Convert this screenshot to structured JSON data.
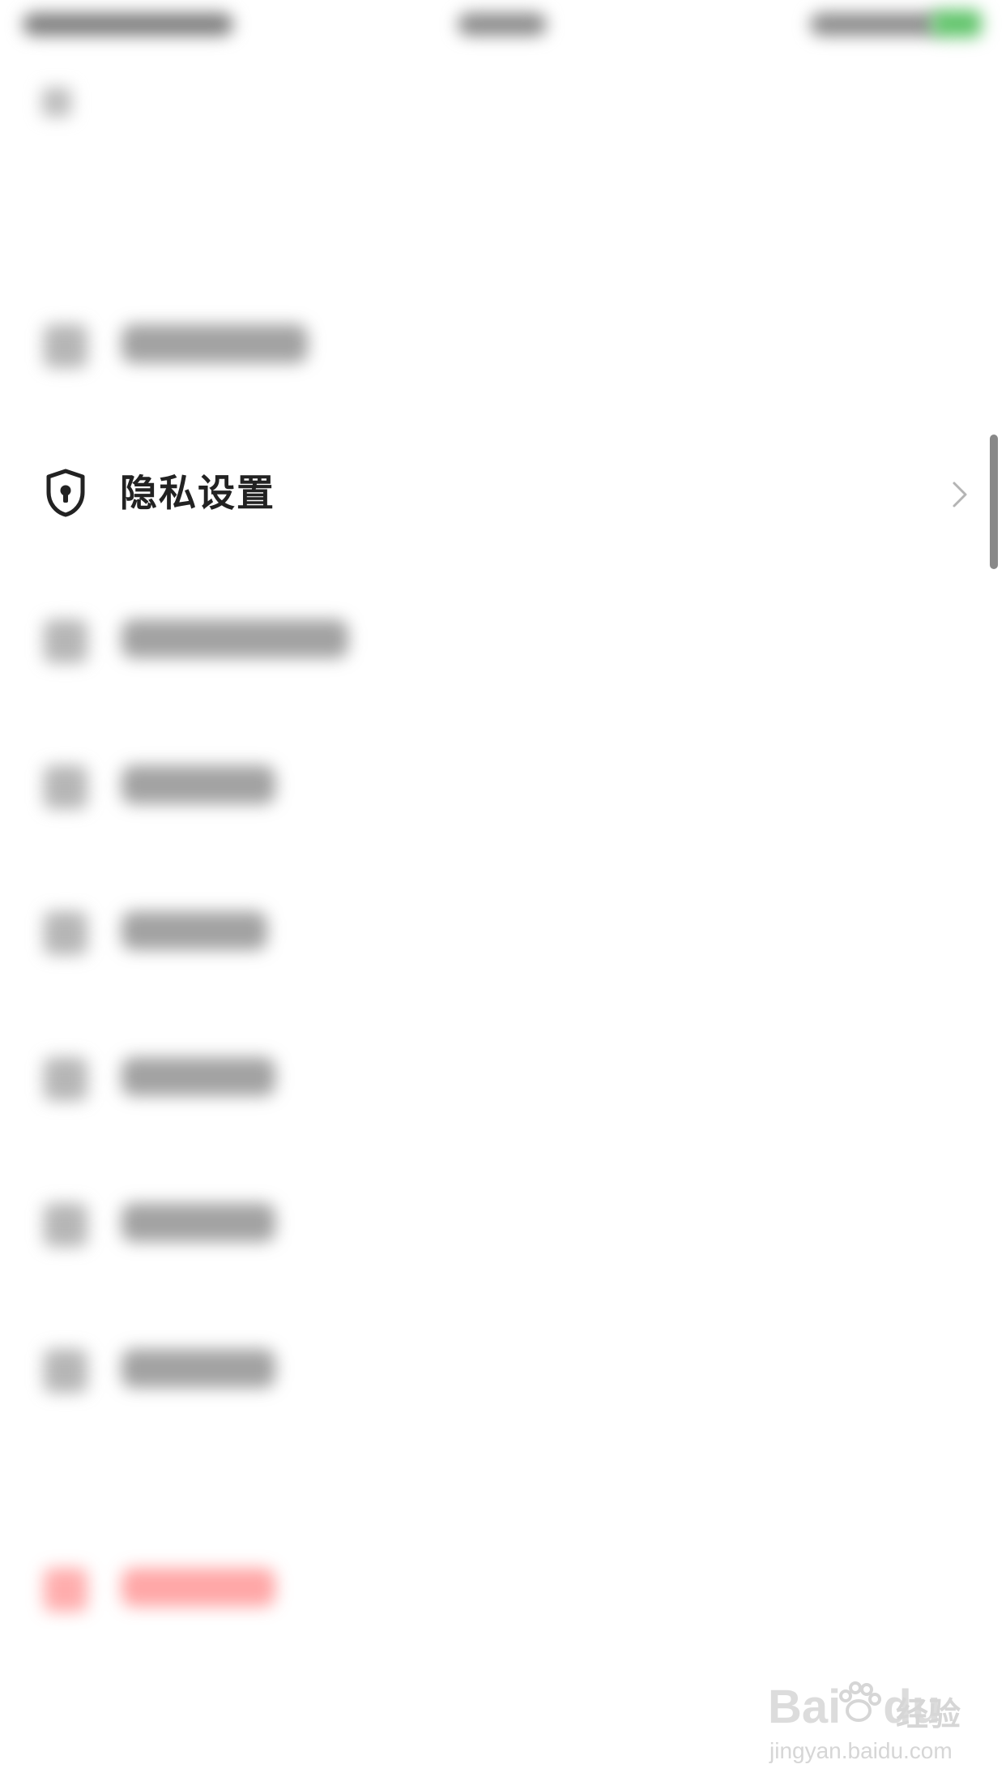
{
  "privacy_row": {
    "label": "隐私设置",
    "icon": "shield-lock-icon",
    "chevron": "chevron-right-icon"
  },
  "blurred_rows": [
    {
      "id": "item-1"
    },
    {
      "id": "item-3"
    },
    {
      "id": "item-4"
    },
    {
      "id": "item-5"
    },
    {
      "id": "item-6"
    },
    {
      "id": "item-7"
    },
    {
      "id": "item-8"
    },
    {
      "id": "item-logout",
      "danger": true
    }
  ],
  "watermark": {
    "brand": "Bai",
    "brand_suffix": "du",
    "cn": "经验",
    "url": "jingyan.baidu.com"
  },
  "colors": {
    "accent_green": "#61c46b",
    "danger_red": "#ff3b3b",
    "text_primary": "#222222"
  }
}
